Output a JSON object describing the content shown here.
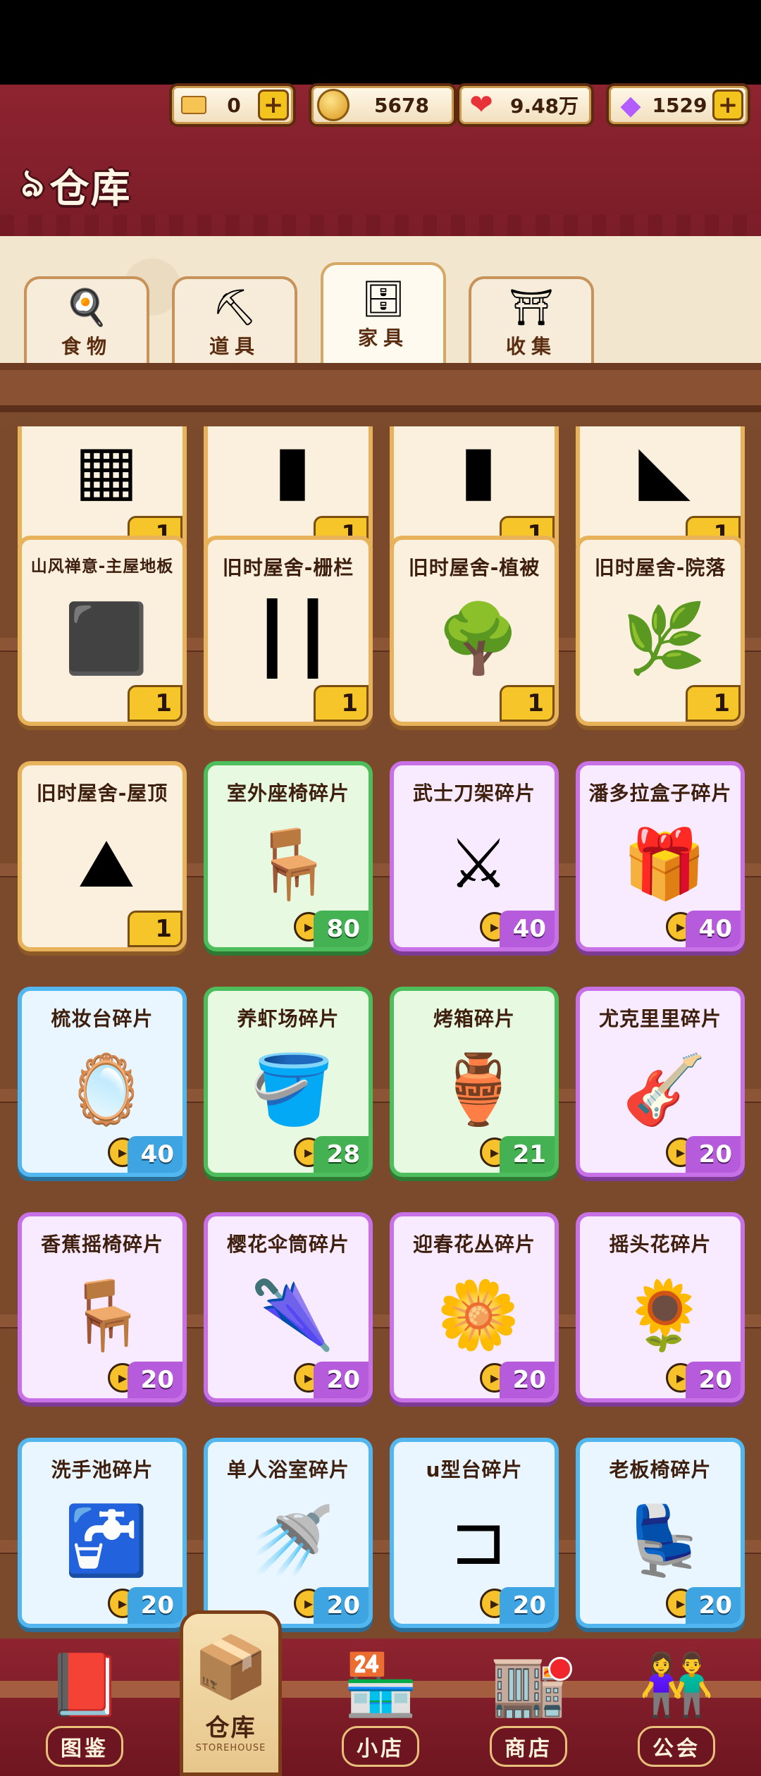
{
  "header": {
    "title": "仓库",
    "resources": [
      {
        "name": "ticket",
        "icon": "ticket-icon",
        "value": "0",
        "has_plus": true
      },
      {
        "name": "coins",
        "icon": "coin-icon",
        "value": "5678",
        "has_plus": false
      },
      {
        "name": "hearts",
        "icon": "heart-icon",
        "value": "9.48万",
        "has_plus": false
      },
      {
        "name": "gems",
        "icon": "gem-icon",
        "value": "1529",
        "has_plus": true
      }
    ],
    "plus_label": "+"
  },
  "tabs": [
    {
      "label": "食物",
      "icon": "egg-icon",
      "active": false
    },
    {
      "label": "道具",
      "icon": "shovel-icon",
      "active": false
    },
    {
      "label": "家具",
      "icon": "cabinet-icon",
      "active": true
    },
    {
      "label": "收集",
      "icon": "torii-icon",
      "active": false
    }
  ],
  "rows": [
    [
      {
        "name": "",
        "count": "1",
        "rarity": "gold",
        "fragment": false
      },
      {
        "name": "",
        "count": "1",
        "rarity": "gold",
        "fragment": false
      },
      {
        "name": "",
        "count": "1",
        "rarity": "gold",
        "fragment": false
      },
      {
        "name": "",
        "count": "1",
        "rarity": "gold",
        "fragment": false
      }
    ],
    [
      {
        "name": "山风禅意-主屋地板",
        "count": "1",
        "rarity": "gold",
        "fragment": false
      },
      {
        "name": "旧时屋舍-栅栏",
        "count": "1",
        "rarity": "gold",
        "fragment": false
      },
      {
        "name": "旧时屋舍-植被",
        "count": "1",
        "rarity": "gold",
        "fragment": false
      },
      {
        "name": "旧时屋舍-院落",
        "count": "1",
        "rarity": "gold",
        "fragment": false
      }
    ],
    [
      {
        "name": "旧时屋舍-屋顶",
        "count": "1",
        "rarity": "gold",
        "fragment": false
      },
      {
        "name": "室外座椅碎片",
        "count": "80",
        "rarity": "green",
        "fragment": true
      },
      {
        "name": "武士刀架碎片",
        "count": "40",
        "rarity": "purple",
        "fragment": true
      },
      {
        "name": "潘多拉盒子碎片",
        "count": "40",
        "rarity": "purple",
        "fragment": true
      }
    ],
    [
      {
        "name": "梳妆台碎片",
        "count": "40",
        "rarity": "blue",
        "fragment": true
      },
      {
        "name": "养虾场碎片",
        "count": "28",
        "rarity": "green",
        "fragment": true
      },
      {
        "name": "烤箱碎片",
        "count": "21",
        "rarity": "green",
        "fragment": true
      },
      {
        "name": "尤克里里碎片",
        "count": "20",
        "rarity": "purple",
        "fragment": true
      }
    ],
    [
      {
        "name": "香蕉摇椅碎片",
        "count": "20",
        "rarity": "purple",
        "fragment": true
      },
      {
        "name": "樱花伞筒碎片",
        "count": "20",
        "rarity": "purple",
        "fragment": true
      },
      {
        "name": "迎春花丛碎片",
        "count": "20",
        "rarity": "purple",
        "fragment": true
      },
      {
        "name": "摇头花碎片",
        "count": "20",
        "rarity": "purple",
        "fragment": true
      }
    ],
    [
      {
        "name": "洗手池碎片",
        "count": "20",
        "rarity": "blue",
        "fragment": true
      },
      {
        "name": "单人浴室碎片",
        "count": "20",
        "rarity": "blue",
        "fragment": true
      },
      {
        "name": "u型台碎片",
        "count": "20",
        "rarity": "blue",
        "fragment": true
      },
      {
        "name": "老板椅碎片",
        "count": "20",
        "rarity": "blue",
        "fragment": true
      }
    ]
  ],
  "item_icons": [
    "▦",
    "▮",
    "▮",
    "◣",
    "⬛",
    "┃┃",
    "🌳",
    "🌿",
    "⛰",
    "🪑",
    "⚔",
    "🎁",
    "🪞",
    "🪣",
    "🏺",
    "🎸",
    "🪑",
    "🌂",
    "🌼",
    "🌻",
    "🚰",
    "🚿",
    "⊐",
    "💺"
  ],
  "nav": [
    {
      "label": "图鉴",
      "icon": "book-icon"
    },
    {
      "label": "仓库",
      "sub": "STOREHOUSE",
      "icon": "boxes-icon",
      "active": true
    },
    {
      "label": "小店",
      "icon": "shop-icon"
    },
    {
      "label": "商店",
      "icon": "store-icon",
      "badge": true
    },
    {
      "label": "公会",
      "icon": "guild-icon"
    }
  ],
  "colors": {
    "header_bg": "#8e2430",
    "gold": "#e7b25a",
    "green": "#4ebd5c",
    "purple": "#c870e6",
    "blue": "#52b7ee"
  }
}
